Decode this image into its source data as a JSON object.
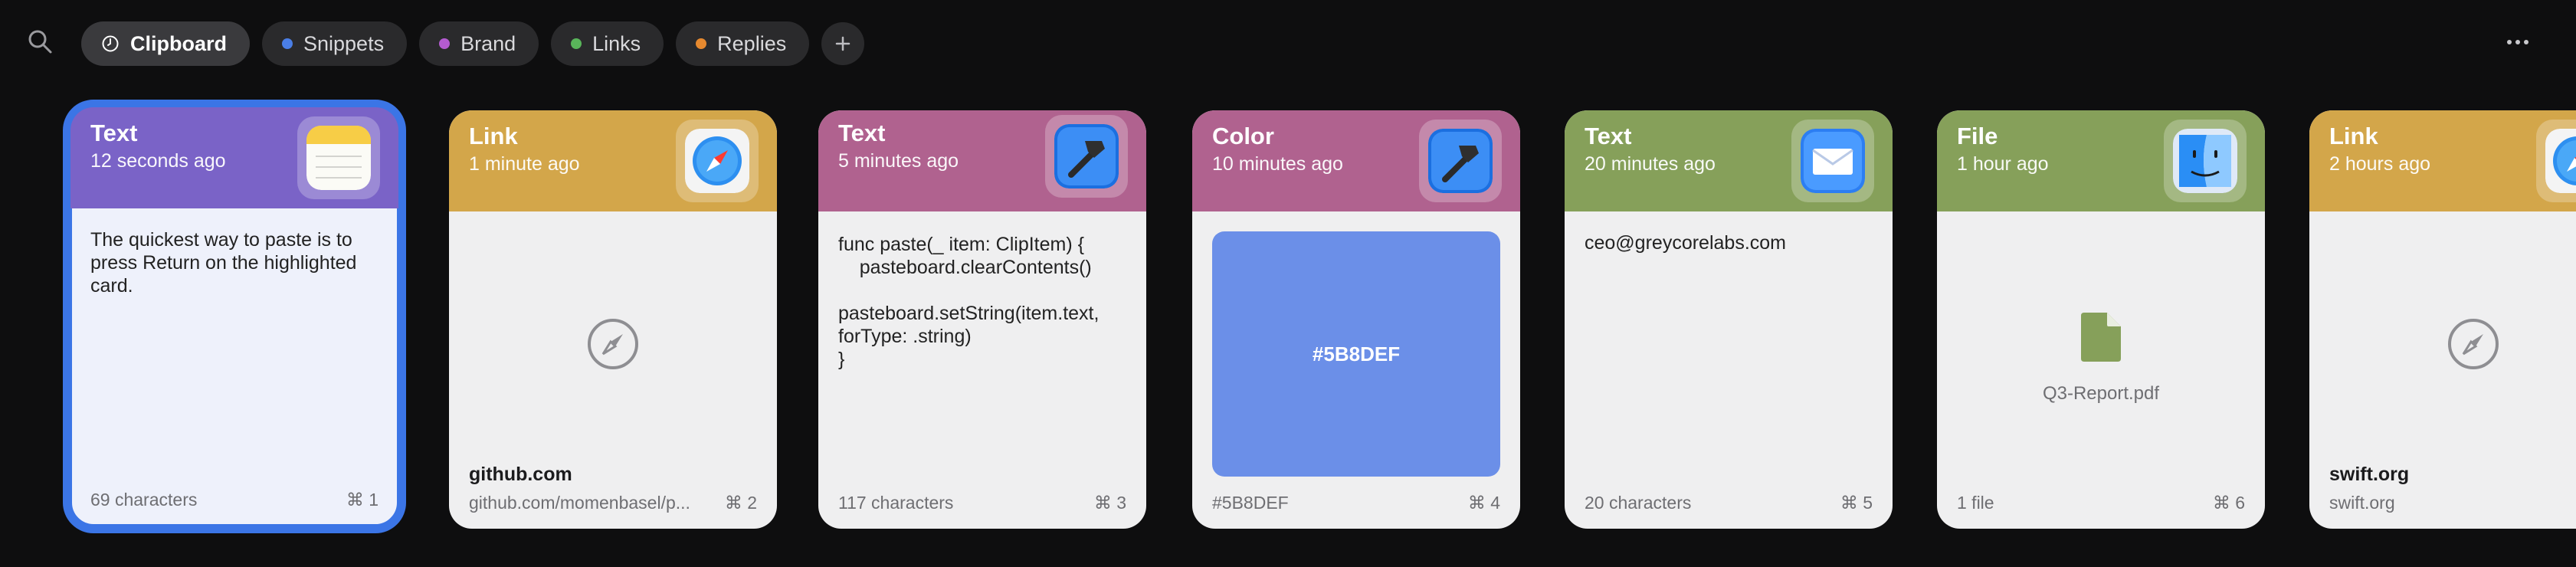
{
  "tabs": [
    {
      "label": "Clipboard",
      "active": true,
      "icon": "clock-icon"
    },
    {
      "label": "Snippets",
      "dot_color": "#4a7ee6"
    },
    {
      "label": "Brand",
      "dot_color": "#b45bd0"
    },
    {
      "label": "Links",
      "dot_color": "#59b55a"
    },
    {
      "label": "Replies",
      "dot_color": "#e6892f"
    }
  ],
  "cards": [
    {
      "type": "Text",
      "time": "12 seconds ago",
      "color": "#7a63c7",
      "app_icon": "notes-icon",
      "body": "The quickest way to paste is to press Return on the highlighted card.",
      "footer_left": "69 characters",
      "shortcut": "⌘ 1"
    },
    {
      "type": "Link",
      "time": "1 minute ago",
      "color": "#d3a64a",
      "app_icon": "safari-icon",
      "link_title": "github.com",
      "link_url": "github.com/momenbasel/p...",
      "shortcut": "⌘ 2"
    },
    {
      "type": "Text",
      "time": "5 minutes ago",
      "color": "#b0628f",
      "app_icon": "xcode-icon",
      "code": "func paste(_ item: ClipItem) {\n    pasteboard.clearContents()\n\npasteboard.setString(item.text,\nforType: .string)\n}",
      "footer_left": "117 characters",
      "shortcut": "⌘ 3"
    },
    {
      "type": "Color",
      "time": "10 minutes ago",
      "color": "#b0628f",
      "app_icon": "xcode-icon",
      "swatch_color": "#5B8DEF",
      "swatch_label": "#5B8DEF",
      "footer_left": "#5B8DEF",
      "shortcut": "⌘ 4"
    },
    {
      "type": "Text",
      "time": "20 minutes ago",
      "color": "#86a05a",
      "app_icon": "mail-icon",
      "body": "ceo@greycorelabs.com",
      "footer_left": "20 characters",
      "shortcut": "⌘ 5"
    },
    {
      "type": "File",
      "time": "1 hour ago",
      "color": "#86a05a",
      "app_icon": "finder-icon",
      "file_name": "Q3-Report.pdf",
      "file_color": "#86a05a",
      "footer_left": "1 file",
      "shortcut": "⌘ 6"
    },
    {
      "type": "Link",
      "time": "2 hours ago",
      "color": "#d3a64a",
      "app_icon": "safari-icon",
      "link_title": "swift.org",
      "link_url": "swift.org"
    }
  ]
}
